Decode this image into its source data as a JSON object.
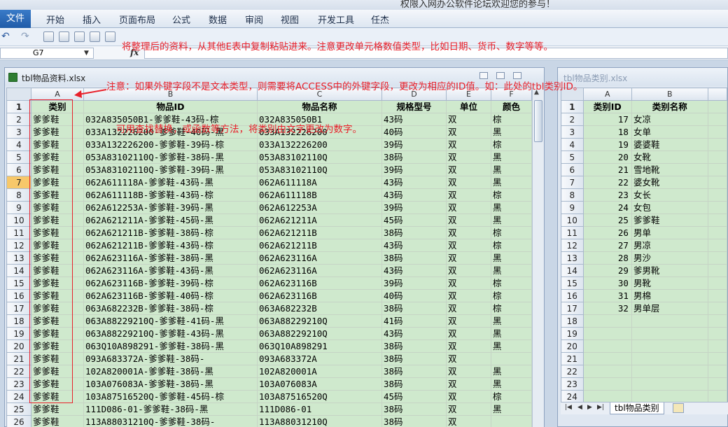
{
  "app": {
    "title": "权限入网办公软件论坛欢迎您的参与！"
  },
  "ribbon_tabs": [
    "文件",
    "开始",
    "插入",
    "页面布局",
    "公式",
    "数据",
    "审阅",
    "视图",
    "开发工具",
    "任杰"
  ],
  "formula_bar": {
    "name_box": "G7",
    "fx": "fx",
    "formula": ""
  },
  "annotations": {
    "note1": "将整理后的资料，从其他E表中复制粘贴进来。注意更改单元格数值类型，比如日期、货币、数字等等。",
    "note2": "注意：如果外键字段不是文本类型，则需要将ACCESS中的外键字段，更改为相应的ID值。如：此处的tbl类别ID。",
    "note3": "可用查找替换，或函数等方法，将类别由文字更改为数字。"
  },
  "window1": {
    "title": "tbl物品资料.xlsx",
    "columns": [
      "A",
      "B",
      "C",
      "D",
      "E",
      "F"
    ],
    "headers": [
      "类别",
      "物品ID",
      "物品名称",
      "规格型号",
      "单位",
      "颜色"
    ],
    "selected_row": 7,
    "rows": [
      [
        "爹爹鞋",
        "032A835050B1-爹爹鞋-43码-棕",
        "032A835050B1",
        "43码",
        "双",
        "棕"
      ],
      [
        "爹爹鞋",
        "033A132226200-爹爹鞋-40码-黑",
        "033A132226200",
        "40码",
        "双",
        "黑"
      ],
      [
        "爹爹鞋",
        "033A132226200-爹爹鞋-39码-棕",
        "033A132226200",
        "39码",
        "双",
        "棕"
      ],
      [
        "爹爹鞋",
        "053A83102110Q-爹爹鞋-38码-黑",
        "053A83102110Q",
        "38码",
        "双",
        "黑"
      ],
      [
        "爹爹鞋",
        "053A83102110Q-爹爹鞋-39码-黑",
        "053A83102110Q",
        "39码",
        "双",
        "黑"
      ],
      [
        "爹爹鞋",
        "062A611118A-爹爹鞋-43码-黑",
        "062A611118A",
        "43码",
        "双",
        "黑"
      ],
      [
        "爹爹鞋",
        "062A611118B-爹爹鞋-43码-棕",
        "062A611118B",
        "43码",
        "双",
        "棕"
      ],
      [
        "爹爹鞋",
        "062A612253A-爹爹鞋-39码-黑",
        "062A612253A",
        "39码",
        "双",
        "黑"
      ],
      [
        "爹爹鞋",
        "062A621211A-爹爹鞋-45码-黑",
        "062A621211A",
        "45码",
        "双",
        "黑"
      ],
      [
        "爹爹鞋",
        "062A621211B-爹爹鞋-38码-棕",
        "062A621211B",
        "38码",
        "双",
        "棕"
      ],
      [
        "爹爹鞋",
        "062A621211B-爹爹鞋-43码-棕",
        "062A621211B",
        "43码",
        "双",
        "棕"
      ],
      [
        "爹爹鞋",
        "062A623116A-爹爹鞋-38码-黑",
        "062A623116A",
        "38码",
        "双",
        "黑"
      ],
      [
        "爹爹鞋",
        "062A623116A-爹爹鞋-43码-黑",
        "062A623116A",
        "43码",
        "双",
        "黑"
      ],
      [
        "爹爹鞋",
        "062A623116B-爹爹鞋-39码-棕",
        "062A623116B",
        "39码",
        "双",
        "棕"
      ],
      [
        "爹爹鞋",
        "062A623116B-爹爹鞋-40码-棕",
        "062A623116B",
        "40码",
        "双",
        "棕"
      ],
      [
        "爹爹鞋",
        "063A682232B-爹爹鞋-38码-棕",
        "063A682232B",
        "38码",
        "双",
        "棕"
      ],
      [
        "爹爹鞋",
        "063A88229210Q-爹爹鞋-41码-黑",
        "063A88229210Q",
        "41码",
        "双",
        "黑"
      ],
      [
        "爹爹鞋",
        "063A88229210Q-爹爹鞋-43码-黑",
        "063A88229210Q",
        "43码",
        "双",
        "黑"
      ],
      [
        "爹爹鞋",
        "063Q10A898291-爹爹鞋-38码-黑",
        "063Q10A898291",
        "38码",
        "双",
        "黑"
      ],
      [
        "爹爹鞋",
        "093A683372A-爹爹鞋-38码-",
        "093A683372A",
        "38码",
        "双",
        ""
      ],
      [
        "爹爹鞋",
        "102A820001A-爹爹鞋-38码-黑",
        "102A820001A",
        "38码",
        "双",
        "黑"
      ],
      [
        "爹爹鞋",
        "103A076083A-爹爹鞋-38码-黑",
        "103A076083A",
        "38码",
        "双",
        "黑"
      ],
      [
        "爹爹鞋",
        "103A87516520Q-爹爹鞋-45码-棕",
        "103A87516520Q",
        "45码",
        "双",
        "棕"
      ],
      [
        "爹爹鞋",
        "111D086-01-爹爹鞋-38码-黑",
        "111D086-01",
        "38码",
        "双",
        "黑"
      ],
      [
        "爹爹鞋",
        "113A88031210Q-爹爹鞋-38码-",
        "113A88031210Q",
        "38码",
        "双",
        ""
      ]
    ]
  },
  "window2": {
    "title": "tbl物品类别.xlsx",
    "columns": [
      "A",
      "B"
    ],
    "headers": [
      "类别ID",
      "类别名称"
    ],
    "rows": [
      [
        "17",
        "女凉"
      ],
      [
        "18",
        "女单"
      ],
      [
        "19",
        "婆婆鞋"
      ],
      [
        "20",
        "女靴"
      ],
      [
        "21",
        "雪地靴"
      ],
      [
        "22",
        "婆女靴"
      ],
      [
        "23",
        "女长"
      ],
      [
        "24",
        "女包"
      ],
      [
        "25",
        "爹爹鞋"
      ],
      [
        "26",
        "男单"
      ],
      [
        "27",
        "男凉"
      ],
      [
        "28",
        "男沙"
      ],
      [
        "29",
        "爹男靴"
      ],
      [
        "30",
        "男靴"
      ],
      [
        "31",
        "男棉"
      ],
      [
        "32",
        "男单层"
      ]
    ],
    "empty_row_labels": [
      "18",
      "19",
      "20",
      "21",
      "22",
      "23",
      "24"
    ],
    "sheet_tab": "tbl物品类别"
  }
}
